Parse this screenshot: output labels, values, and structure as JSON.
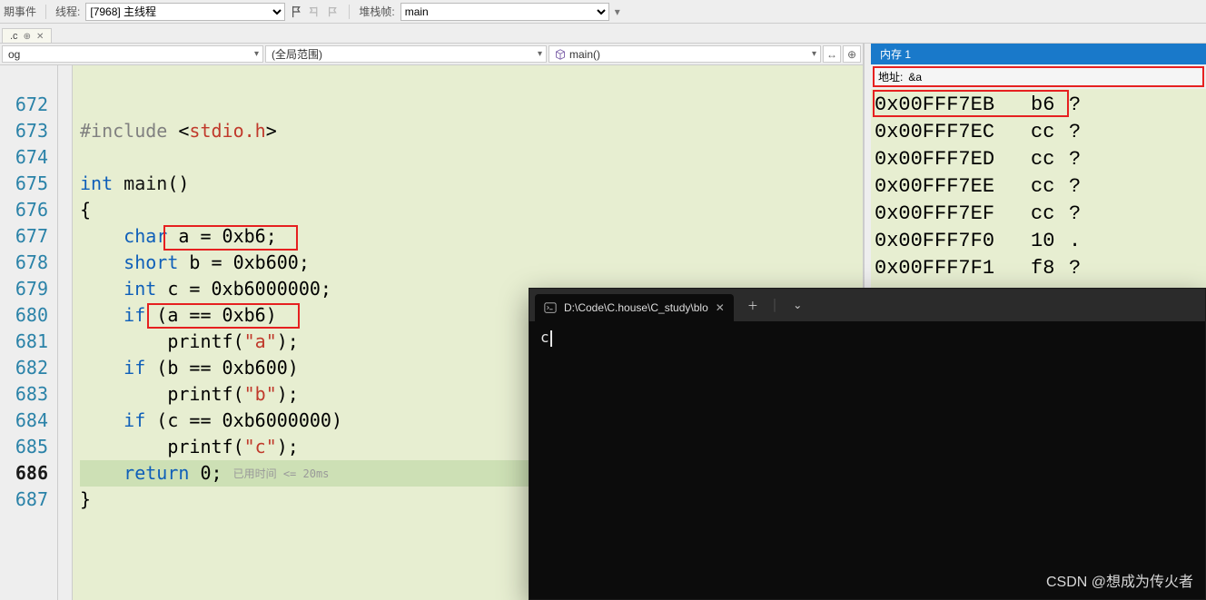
{
  "toolbar": {
    "events_label": "期事件",
    "thread_label": "线程:",
    "thread_value": "[7968] 主线程",
    "stackframe_label": "堆栈帧:",
    "stackframe_value": "main"
  },
  "file_tab": {
    "name": ".c"
  },
  "editor": {
    "scope_dd": "og",
    "range_dd": "(全局范围)",
    "fn_dd": "main()",
    "lines": [
      {
        "n": "",
        "html": ""
      },
      {
        "n": "672",
        "html": ""
      },
      {
        "n": "673",
        "html": "<span class='t-prep'>#include</span> &lt;<span class='t-str'>stdio.h</span>&gt;"
      },
      {
        "n": "674",
        "html": ""
      },
      {
        "n": "675",
        "html": "<span class='t-kw'>int</span> <span class='t-fn'>main</span>()"
      },
      {
        "n": "676",
        "html": "{"
      },
      {
        "n": "677",
        "html": "    <span class='t-kw'>char</span> a = 0xb6;"
      },
      {
        "n": "678",
        "html": "    <span class='t-kw'>short</span> b = 0xb600;"
      },
      {
        "n": "679",
        "html": "    <span class='t-kw'>int</span> c = 0xb6000000;"
      },
      {
        "n": "680",
        "html": "    <span class='t-kw'>if</span> (a == 0xb6)"
      },
      {
        "n": "681",
        "html": "        printf(<span class='t-str'>\"a\"</span>);"
      },
      {
        "n": "682",
        "html": "    <span class='t-kw'>if</span> (b == 0xb600)"
      },
      {
        "n": "683",
        "html": "        printf(<span class='t-str'>\"b\"</span>);"
      },
      {
        "n": "684",
        "html": "    <span class='t-kw'>if</span> (c == 0xb6000000)"
      },
      {
        "n": "685",
        "html": "        printf(<span class='t-str'>\"c\"</span>);"
      },
      {
        "n": "686",
        "html": "    <span class='t-kw'>return</span> 0; <span class='t-hint'>已用时间 &lt;= 20ms</span>",
        "current": true
      },
      {
        "n": "687",
        "html": "}"
      }
    ]
  },
  "memory": {
    "title": "内存 1",
    "addr_label": "地址:",
    "addr_value": "&a",
    "rows": [
      {
        "addr": "0x00FFF7EB",
        "val": "b6",
        "ch": "?"
      },
      {
        "addr": "0x00FFF7EC",
        "val": "cc",
        "ch": "?"
      },
      {
        "addr": "0x00FFF7ED",
        "val": "cc",
        "ch": "?"
      },
      {
        "addr": "0x00FFF7EE",
        "val": "cc",
        "ch": "?"
      },
      {
        "addr": "0x00FFF7EF",
        "val": "cc",
        "ch": "?"
      },
      {
        "addr": "0x00FFF7F0",
        "val": "10",
        "ch": "."
      },
      {
        "addr": "0x00FFF7F1",
        "val": "f8",
        "ch": "?"
      }
    ]
  },
  "terminal": {
    "tab_title": "D:\\Code\\C.house\\C_study\\blo",
    "output": "c"
  },
  "watermark": "CSDN @想成为传火者"
}
